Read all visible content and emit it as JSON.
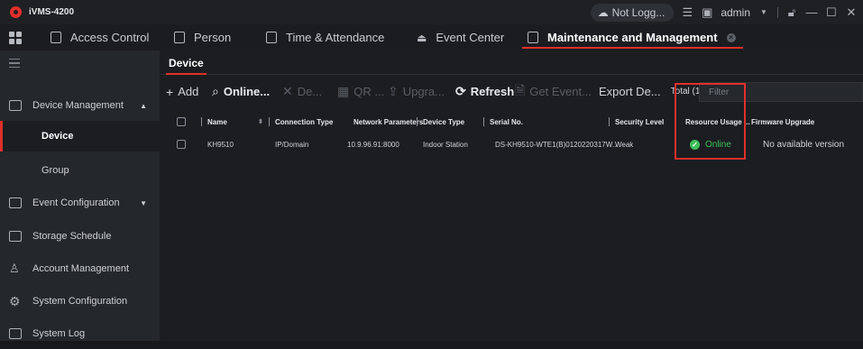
{
  "app": {
    "name": "iVMS-4200"
  },
  "titlebar": {
    "cloud_status": "Not Logg...",
    "user": "admin"
  },
  "nav": {
    "items": [
      {
        "label": "Access Control"
      },
      {
        "label": "Person"
      },
      {
        "label": "Time & Attendance"
      },
      {
        "label": "Event Center"
      },
      {
        "label": "Maintenance and Management"
      }
    ]
  },
  "sidebar": {
    "items": [
      {
        "label": "Device Management"
      },
      {
        "label": "Device"
      },
      {
        "label": "Group"
      },
      {
        "label": "Event Configuration"
      },
      {
        "label": "Storage Schedule"
      },
      {
        "label": "Account Management"
      },
      {
        "label": "System Configuration"
      },
      {
        "label": "System Log"
      }
    ]
  },
  "main": {
    "tab": "Device",
    "toolbar": {
      "add": "Add",
      "online": "Online...",
      "delete": "De...",
      "qr": "QR ...",
      "upgrade": "Upgra...",
      "refresh": "Refresh",
      "get_event": "Get Event...",
      "export": "Export De...",
      "total": "Total (1)",
      "filter_placeholder": "Filter"
    },
    "table": {
      "headers": [
        "Name",
        "Connection Type",
        "Network Parameters",
        "Device Type",
        "Serial No.",
        "Security Level",
        "Resource Usage ...",
        "Firmware Upgrade"
      ],
      "rows": [
        {
          "name": "KH9510",
          "connection_type": "IP/Domain",
          "network": "10.9.96.91:8000",
          "device_type": "Indoor Station",
          "serial": "DS-KH9510-WTE1(B)0120220317W...",
          "security": "Weak",
          "resource": "Online",
          "firmware": "No available version"
        }
      ]
    }
  },
  "colors": {
    "accent": "#e0302a",
    "online": "#3fbf5a",
    "background": "#16181c"
  }
}
